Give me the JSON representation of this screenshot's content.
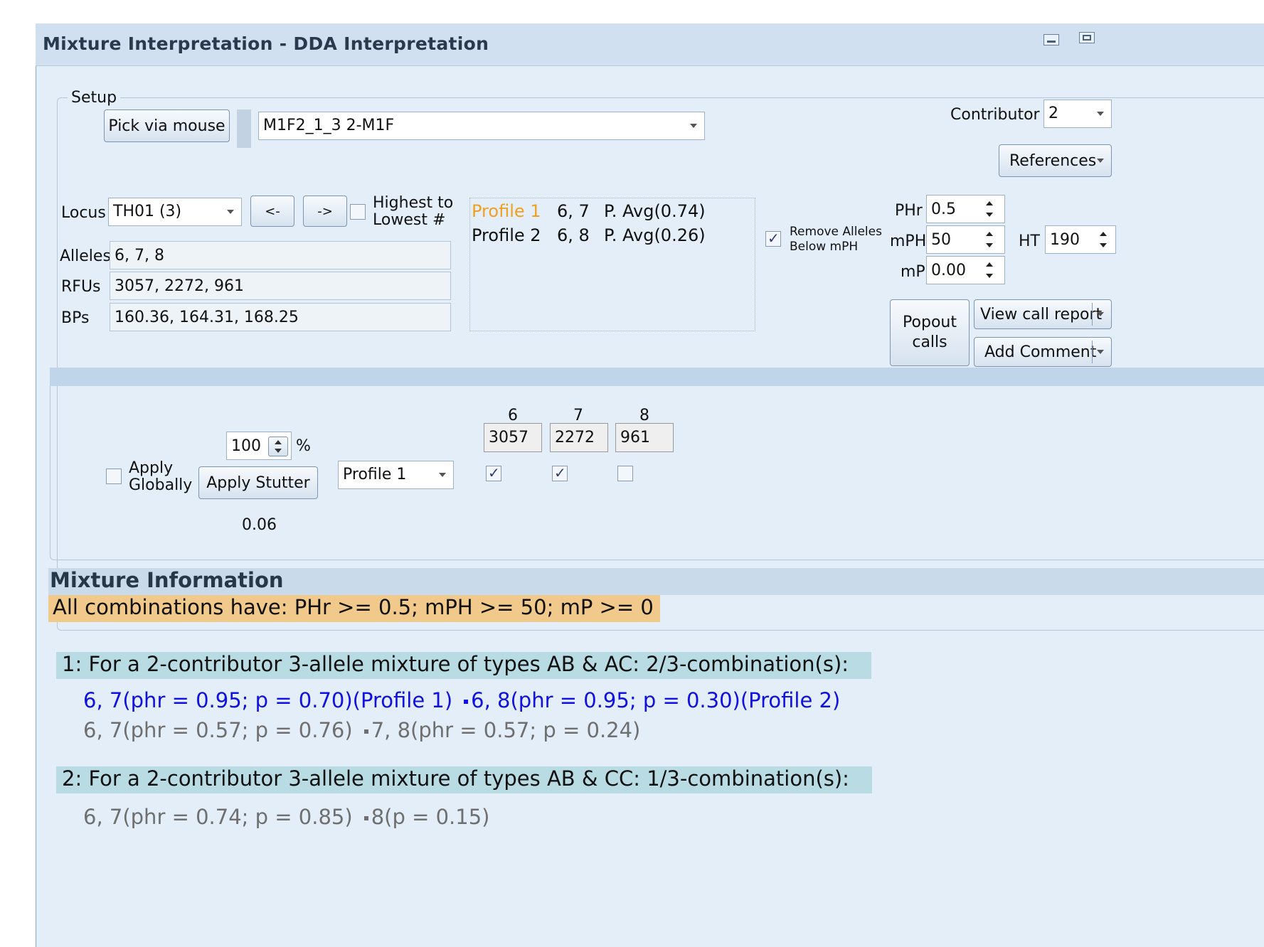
{
  "window": {
    "title": "Mixture Interpretation - DDA Interpretation"
  },
  "setup": {
    "group_label": "Setup",
    "pick_button": "Pick via mouse",
    "sample_value": "M1F2_1_3 2-M1F",
    "contributor_label": "Contributor #",
    "contributor_value": "2",
    "references_button": "References",
    "locus_label": "Locus",
    "locus_value": "TH01 (3)",
    "prev_button": "<-",
    "next_button": "->",
    "highest_label_1": "Highest to",
    "highest_label_2": "Lowest #",
    "highest_checked": false,
    "alleles_label": "Alleles",
    "alleles_value": "6, 7, 8",
    "rfus_label": "RFUs",
    "rfus_value": "3057, 2272, 961",
    "bps_label": "BPs",
    "bps_value": "160.36, 164.31, 168.25",
    "profiles": [
      {
        "name": "Profile 1",
        "alleles": "6, 7",
        "avg": "P. Avg(0.74)",
        "highlight_color": "#f0a020"
      },
      {
        "name": "Profile 2",
        "alleles": "6, 8",
        "avg": "P. Avg(0.26)",
        "highlight_color": "#111111"
      }
    ],
    "remove_alleles_label_1": "Remove Alleles",
    "remove_alleles_label_2": "Below mPH",
    "remove_alleles_checked": true,
    "phr_label": "PHr",
    "phr_value": "0.5",
    "mph_label": "mPH",
    "mph_value": "50",
    "mp_label": "mP",
    "mp_value": "0.00",
    "ht_label": "HT",
    "ht_value": "190",
    "popout_label_1": "Popout",
    "popout_label_2": "calls",
    "view_call_report": "View call report",
    "add_comment": "Add Comment"
  },
  "stutter": {
    "percent_value": "100",
    "percent_sign": "%",
    "apply_globally_1": "Apply",
    "apply_globally_2": "Globally",
    "apply_globally_checked": false,
    "apply_stutter_button": "Apply Stutter",
    "stutter_value": "0.06",
    "profile_select": "Profile 1",
    "alleles": [
      {
        "allele": "6",
        "rfu": "3057",
        "checked": true
      },
      {
        "allele": "7",
        "rfu": "2272",
        "checked": true
      },
      {
        "allele": "8",
        "rfu": "961",
        "checked": false
      }
    ]
  },
  "mixture": {
    "header": "Mixture Information",
    "summary": "All combinations have: PHr >= 0.5; mPH >= 50; mP >= 0",
    "groups": [
      {
        "heading": "1: For a 2-contributor 3-allele mixture of types AB & AC: 2/3-combination(s):",
        "lines": [
          {
            "part1": "6, 7(phr = 0.95; p = 0.70)(Profile 1)",
            "part2": "6, 8(phr = 0.95; p = 0.30)(Profile 2)",
            "style": "blue"
          },
          {
            "part1": "6, 7(phr = 0.57; p = 0.76)",
            "part2": "7, 8(phr = 0.57; p = 0.24)",
            "style": "gray"
          }
        ]
      },
      {
        "heading": "2: For a 2-contributor 3-allele mixture of types AB & CC: 1/3-combination(s):",
        "lines": [
          {
            "part1": "6, 7(phr = 0.74; p = 0.85)",
            "part2": "8(p = 0.15)",
            "style": "gray"
          }
        ]
      }
    ]
  }
}
